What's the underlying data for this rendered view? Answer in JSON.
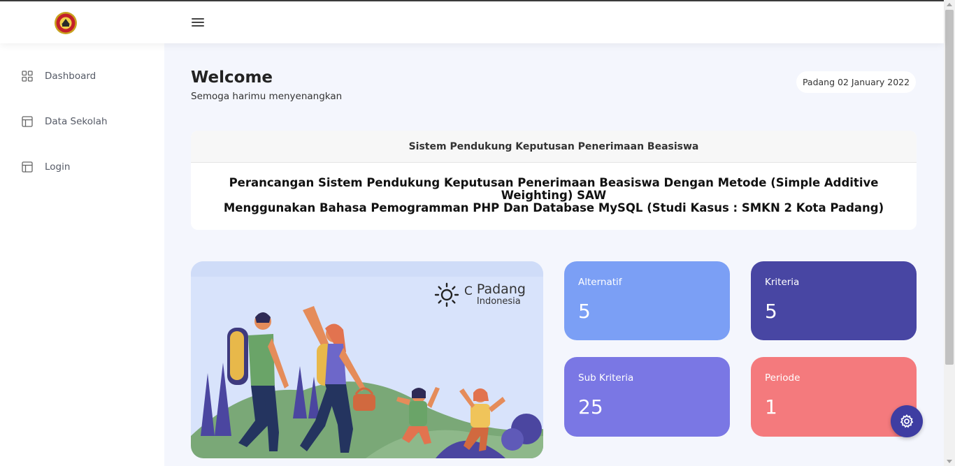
{
  "topbar": {
    "logo": "school-emblem",
    "menu_icon": "hamburger-icon"
  },
  "sidebar": {
    "items": [
      {
        "label": "Dashboard",
        "icon": "grid-icon"
      },
      {
        "label": "Data Sekolah",
        "icon": "table-layout-icon"
      },
      {
        "label": "Login",
        "icon": "table-layout-icon"
      }
    ]
  },
  "header": {
    "title": "Welcome",
    "subtitle": "Semoga harimu menyenangkan",
    "date": "Padang 02 January 2022"
  },
  "info_card": {
    "header": "Sistem Pendukung Keputusan Penerimaan Beasiswa",
    "line1": "Perancangan Sistem Pendukung Keputusan Penerimaan Beasiswa Dengan Metode (Simple Additive Weighting) SAW",
    "line2": "Menggunakan Bahasa Pemogramman PHP Dan Database MySQL (Studi Kasus : SMKN 2 Kota Padang)"
  },
  "weather": {
    "icon": "sun-icon",
    "unit": "C",
    "city": "Padang",
    "country": "Indonesia"
  },
  "stats": [
    {
      "title": "Alternatif",
      "value": "5",
      "color": "#7b9ff5"
    },
    {
      "title": "Kriteria",
      "value": "5",
      "color": "#4846a3"
    },
    {
      "title": "Sub Kriteria",
      "value": "25",
      "color": "#7a77e4"
    },
    {
      "title": "Periode",
      "value": "1",
      "color": "#f47a7d"
    }
  ],
  "fab": {
    "icon": "gear-icon"
  }
}
